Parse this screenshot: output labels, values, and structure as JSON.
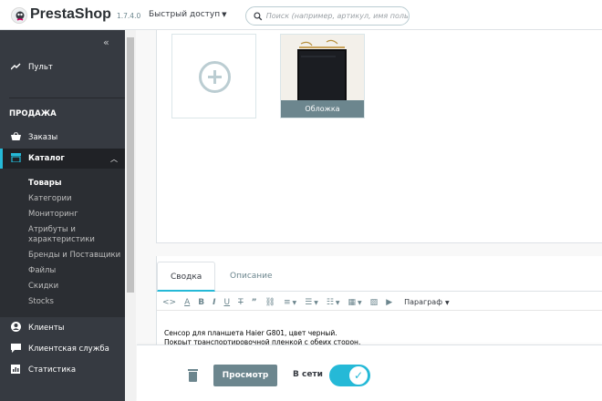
{
  "header": {
    "brand": "PrestaShop",
    "version": "1.7.4.0",
    "quick_access": "Быстрый доступ",
    "search_placeholder": "Поиск (например, артикул, имя польз"
  },
  "sidebar": {
    "dashboard": "Пульт",
    "section_title": "ПРОДАЖА",
    "orders": "Заказы",
    "catalog": "Каталог",
    "catalog_submenu": [
      "Товары",
      "Категории",
      "Мониторинг",
      "Атрибуты и",
      "характеристики",
      "Бренды и Поставщики",
      "Файлы",
      "Скидки",
      "Stocks"
    ],
    "customers": "Клиенты",
    "customer_service": "Клиентская служба",
    "stats": "Статистика"
  },
  "images": {
    "cover_label": "Обложка"
  },
  "description": {
    "tabs": [
      "Сводка",
      "Описание"
    ],
    "paragraph_format": "Параграф",
    "text_lines": [
      "Сенсор для планшета Haier G801, цвет черный.",
      "Покрыт транспортировочной пленкой с обеих сторон."
    ]
  },
  "footer": {
    "preview": "Просмотр",
    "online": "В сети",
    "online_enabled": true
  },
  "colors": {
    "accent": "#25b9d7",
    "sidebar_bg": "#363a41",
    "button_gray": "#6c868e"
  }
}
